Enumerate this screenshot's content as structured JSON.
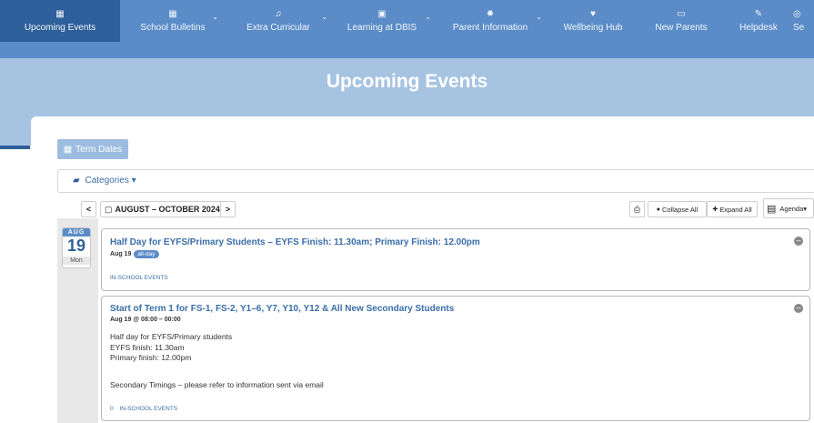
{
  "nav": {
    "items": [
      {
        "label": "Upcoming Events",
        "icon": "calendar-icon",
        "glyph": "▦",
        "active": true
      },
      {
        "label": "School Bulletins",
        "icon": "calendar-icon",
        "glyph": "▦",
        "has_dropdown": true
      },
      {
        "label": "Extra Curricular",
        "icon": "music-icon",
        "glyph": "♫",
        "has_dropdown": true
      },
      {
        "label": "Learning at DBIS",
        "icon": "briefcase-icon",
        "glyph": "▣",
        "has_dropdown": true
      },
      {
        "label": "Parent Information",
        "icon": "gear-icon",
        "glyph": "✹",
        "has_dropdown": true
      },
      {
        "label": "Wellbeing Hub",
        "icon": "heart-icon",
        "glyph": "♥"
      },
      {
        "label": "New Parents",
        "icon": "laptop-icon",
        "glyph": "▭"
      },
      {
        "label": "Helpdesk",
        "icon": "edit-icon",
        "glyph": "✎"
      },
      {
        "label": "Se",
        "icon": "search-icon",
        "glyph": "◎"
      }
    ],
    "chevron": "⌄"
  },
  "hero": {
    "title": "Upcoming Events"
  },
  "term_dates": {
    "label": "Term Dates",
    "icon": "▦"
  },
  "categories": {
    "label": "Categories",
    "icon": "▰",
    "caret": "▾"
  },
  "toolbar": {
    "prev": "<",
    "next": ">",
    "range": "AUGUST – OCTOBER 2024",
    "range_icon": "▢",
    "print_icon": "⎙",
    "collapse_all": "Collapse All",
    "expand_all": "Expand All",
    "collapse_icon": "●",
    "expand_icon": "✚",
    "view": "Agenda",
    "view_icon": "▤",
    "view_caret": "▾"
  },
  "date": {
    "month": "AUG",
    "day": "19",
    "weekday": "Mon"
  },
  "events": [
    {
      "title": "Half Day for EYFS/Primary Students – EYFS Finish: 11.30am; Primary Finish: 12.00pm",
      "date": "Aug 19",
      "badge": "all-day",
      "category": "IN-SCHOOL EVENTS",
      "collapse_glyph": "–"
    },
    {
      "title": "Start of Term 1 for FS-1, FS-2, Y1–6, Y7, Y10, Y12 & All New Secondary Students",
      "date": "Aug 19 @ 08:00 – 00:00",
      "body_lines": [
        "Half day for EYFS/Primary students",
        "EYFS finish: 11.30am",
        "Primary finish: 12.00pm"
      ],
      "body_note": "Secondary Timings – please refer to information sent via email",
      "category": "IN-SCHOOL EVENTS",
      "category_prefix": "0",
      "collapse_glyph": "–"
    }
  ],
  "colors": {
    "nav": "#5b8cc7",
    "nav_active": "#2f5f9a",
    "hero": "#a6c3e2",
    "accent": "#3a6da8"
  }
}
